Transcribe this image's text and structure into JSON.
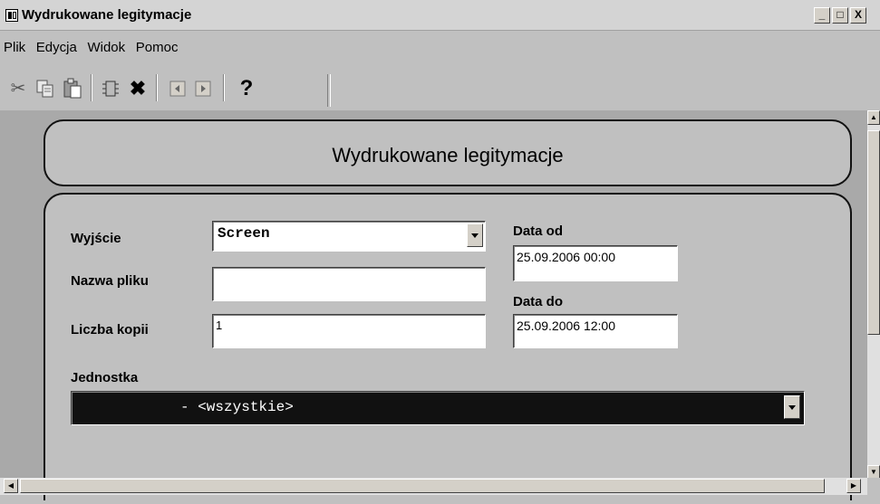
{
  "window": {
    "title": "Wydrukowane legitymacje",
    "controls": [
      "_",
      "□",
      "X"
    ]
  },
  "menu": [
    "Plik",
    "Edycja",
    "Widok",
    "Pomoc"
  ],
  "toolbar": {
    "icons": [
      "cut-icon",
      "copy-icon",
      "paste-icon",
      "tool-icon",
      "delete-icon",
      "prev-icon",
      "next-icon",
      "help-icon"
    ],
    "help_label": "?"
  },
  "form": {
    "title": "Wydrukowane legitymacje",
    "output_label": "Wyjście",
    "output_value": "Screen",
    "filename_label": "Nazwa pliku",
    "filename_value": "",
    "copies_label": "Liczba kopii",
    "copies_value": "1",
    "date_from_label": "Data od",
    "date_from_value": "25.09.2006 00:00",
    "date_to_label": "Data do",
    "date_to_value": "25.09.2006 12:00",
    "unit_label": "Jednostka",
    "unit_value": "- <wszystkie>"
  }
}
